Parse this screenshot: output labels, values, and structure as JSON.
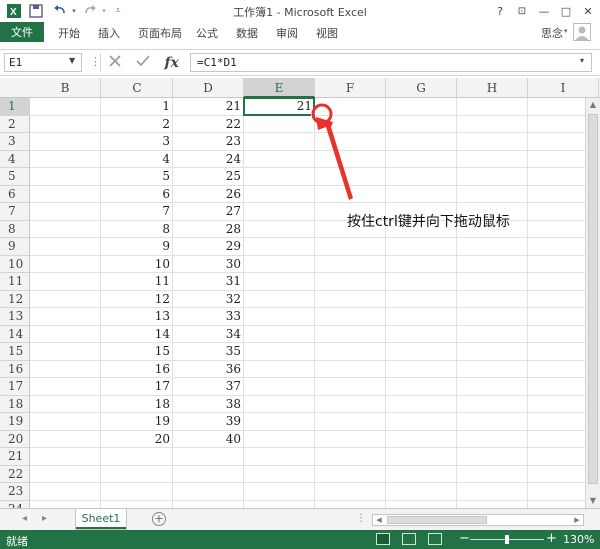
{
  "window": {
    "title": "工作簿1 - Microsoft Excel",
    "help": "?",
    "minimize": "—",
    "restore": "□",
    "close": "✕"
  },
  "ribbon": {
    "file_tab": "文件",
    "tabs": [
      "开始",
      "插入",
      "页面布局",
      "公式",
      "数据",
      "审阅",
      "视图"
    ],
    "user": "思念"
  },
  "formula_bar": {
    "name_box": "E1",
    "formula": "=C1*D1",
    "fx_label": "fx"
  },
  "columns": [
    "B",
    "C",
    "D",
    "E",
    "F",
    "G",
    "H",
    "I"
  ],
  "selected_column": "E",
  "rows": [
    1,
    2,
    3,
    4,
    5,
    6,
    7,
    8,
    9,
    10,
    11,
    12,
    13,
    14,
    15,
    16,
    17,
    18,
    19,
    20,
    21,
    22,
    23,
    24
  ],
  "selected_row": 1,
  "cells": {
    "C": [
      "1",
      "2",
      "3",
      "4",
      "5",
      "6",
      "7",
      "8",
      "9",
      "10",
      "11",
      "12",
      "13",
      "14",
      "15",
      "16",
      "17",
      "18",
      "19",
      "20"
    ],
    "D": [
      "21",
      "22",
      "23",
      "24",
      "25",
      "26",
      "27",
      "28",
      "29",
      "30",
      "31",
      "32",
      "33",
      "34",
      "35",
      "36",
      "37",
      "38",
      "39",
      "40"
    ],
    "E1": "21"
  },
  "annotation": {
    "text": "按住ctrl键并向下拖动鼠标",
    "color": "#e8332a"
  },
  "sheet_tabs": {
    "active": "Sheet1",
    "add_label": "+"
  },
  "status_bar": {
    "status": "就绪",
    "zoom": "130%",
    "zoom_minus": "−",
    "zoom_plus": "+"
  },
  "colors": {
    "accent": "#217346",
    "status_bar": "#217346"
  }
}
